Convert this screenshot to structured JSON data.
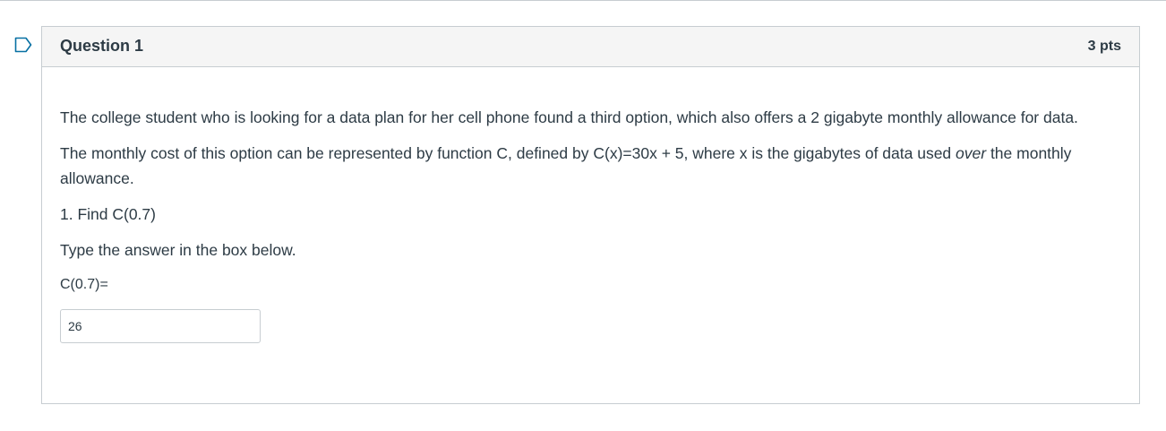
{
  "question": {
    "title": "Question 1",
    "points": "3 pts",
    "paragraphs": {
      "intro": "The college student who is looking for a data plan for her cell phone found a third option, which also offers a 2 gigabyte monthly allowance for data.",
      "cost_before": "The monthly cost of this option can be represented by function C, defined by C(x)=30x + 5, where x is the gigabytes of data used ",
      "cost_emphasis": "over",
      "cost_after": " the monthly allowance.",
      "task": "1. Find C(0.7)",
      "instruction": "Type the answer in the box below.",
      "answer_label": "C(0.7)="
    },
    "answer": {
      "value": "26"
    }
  },
  "colors": {
    "text": "#2d3b45",
    "border": "#c7cdd1",
    "header_bg": "#f5f5f5",
    "flag": "#0770a3"
  },
  "icons": {
    "flag": "bookmark-flag-icon"
  }
}
